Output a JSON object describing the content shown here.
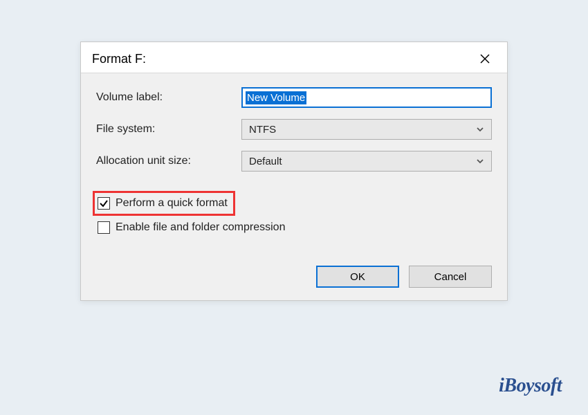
{
  "dialog": {
    "title": "Format F:",
    "fields": {
      "volume_label": {
        "label": "Volume label:",
        "value": "New Volume"
      },
      "file_system": {
        "label": "File system:",
        "value": "NTFS"
      },
      "allocation": {
        "label": "Allocation unit size:",
        "value": "Default"
      }
    },
    "checkboxes": {
      "quick_format": {
        "label": "Perform a quick format",
        "checked": true
      },
      "compression": {
        "label": "Enable file and folder compression",
        "checked": false
      }
    },
    "buttons": {
      "ok": "OK",
      "cancel": "Cancel"
    }
  },
  "watermark": "iBoysoft"
}
